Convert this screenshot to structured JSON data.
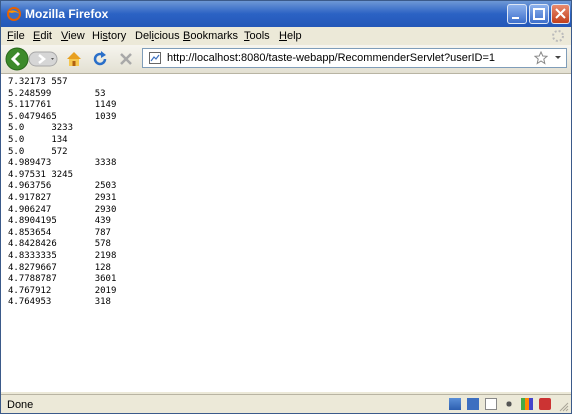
{
  "window": {
    "title": "Mozilla Firefox"
  },
  "menu": {
    "items": [
      {
        "accel": "F",
        "rest": "ile"
      },
      {
        "accel": "E",
        "rest": "dit"
      },
      {
        "accel": "V",
        "rest": "iew"
      },
      {
        "accel": "",
        "pre": "Hi",
        "accelMid": "s",
        "rest": "tory"
      },
      {
        "accel": "",
        "pre": "Del",
        "accelMid": "i",
        "rest": "cious"
      },
      {
        "accel": "B",
        "rest": "ookmarks"
      },
      {
        "accel": "T",
        "rest": "ools"
      },
      {
        "accel": "H",
        "rest": "elp"
      }
    ]
  },
  "nav": {
    "url": "http://localhost:8080/taste-webapp/RecommenderServlet?userID=1",
    "icons": [
      "back-icon",
      "forward-icon",
      "history-dropdown-icon",
      "home-icon",
      "reload-icon",
      "stop-icon",
      "page-icon",
      "bookmark-star-icon",
      "url-dropdown-icon"
    ]
  },
  "content": {
    "rows": [
      "7.32173 557",
      "5.248599        53",
      "5.117761        1149",
      "5.0479465       1039",
      "5.0     3233",
      "5.0     134",
      "5.0     572",
      "4.989473        3338",
      "4.97531 3245",
      "4.963756        2503",
      "4.917827        2931",
      "4.906247        2930",
      "4.8904195       439",
      "4.853654        787",
      "4.8428426       578",
      "4.8333335       2198",
      "4.8279667       128",
      "4.7788787       3601",
      "4.767912        2019",
      "4.764953        318"
    ]
  },
  "status": {
    "text": "Done"
  }
}
